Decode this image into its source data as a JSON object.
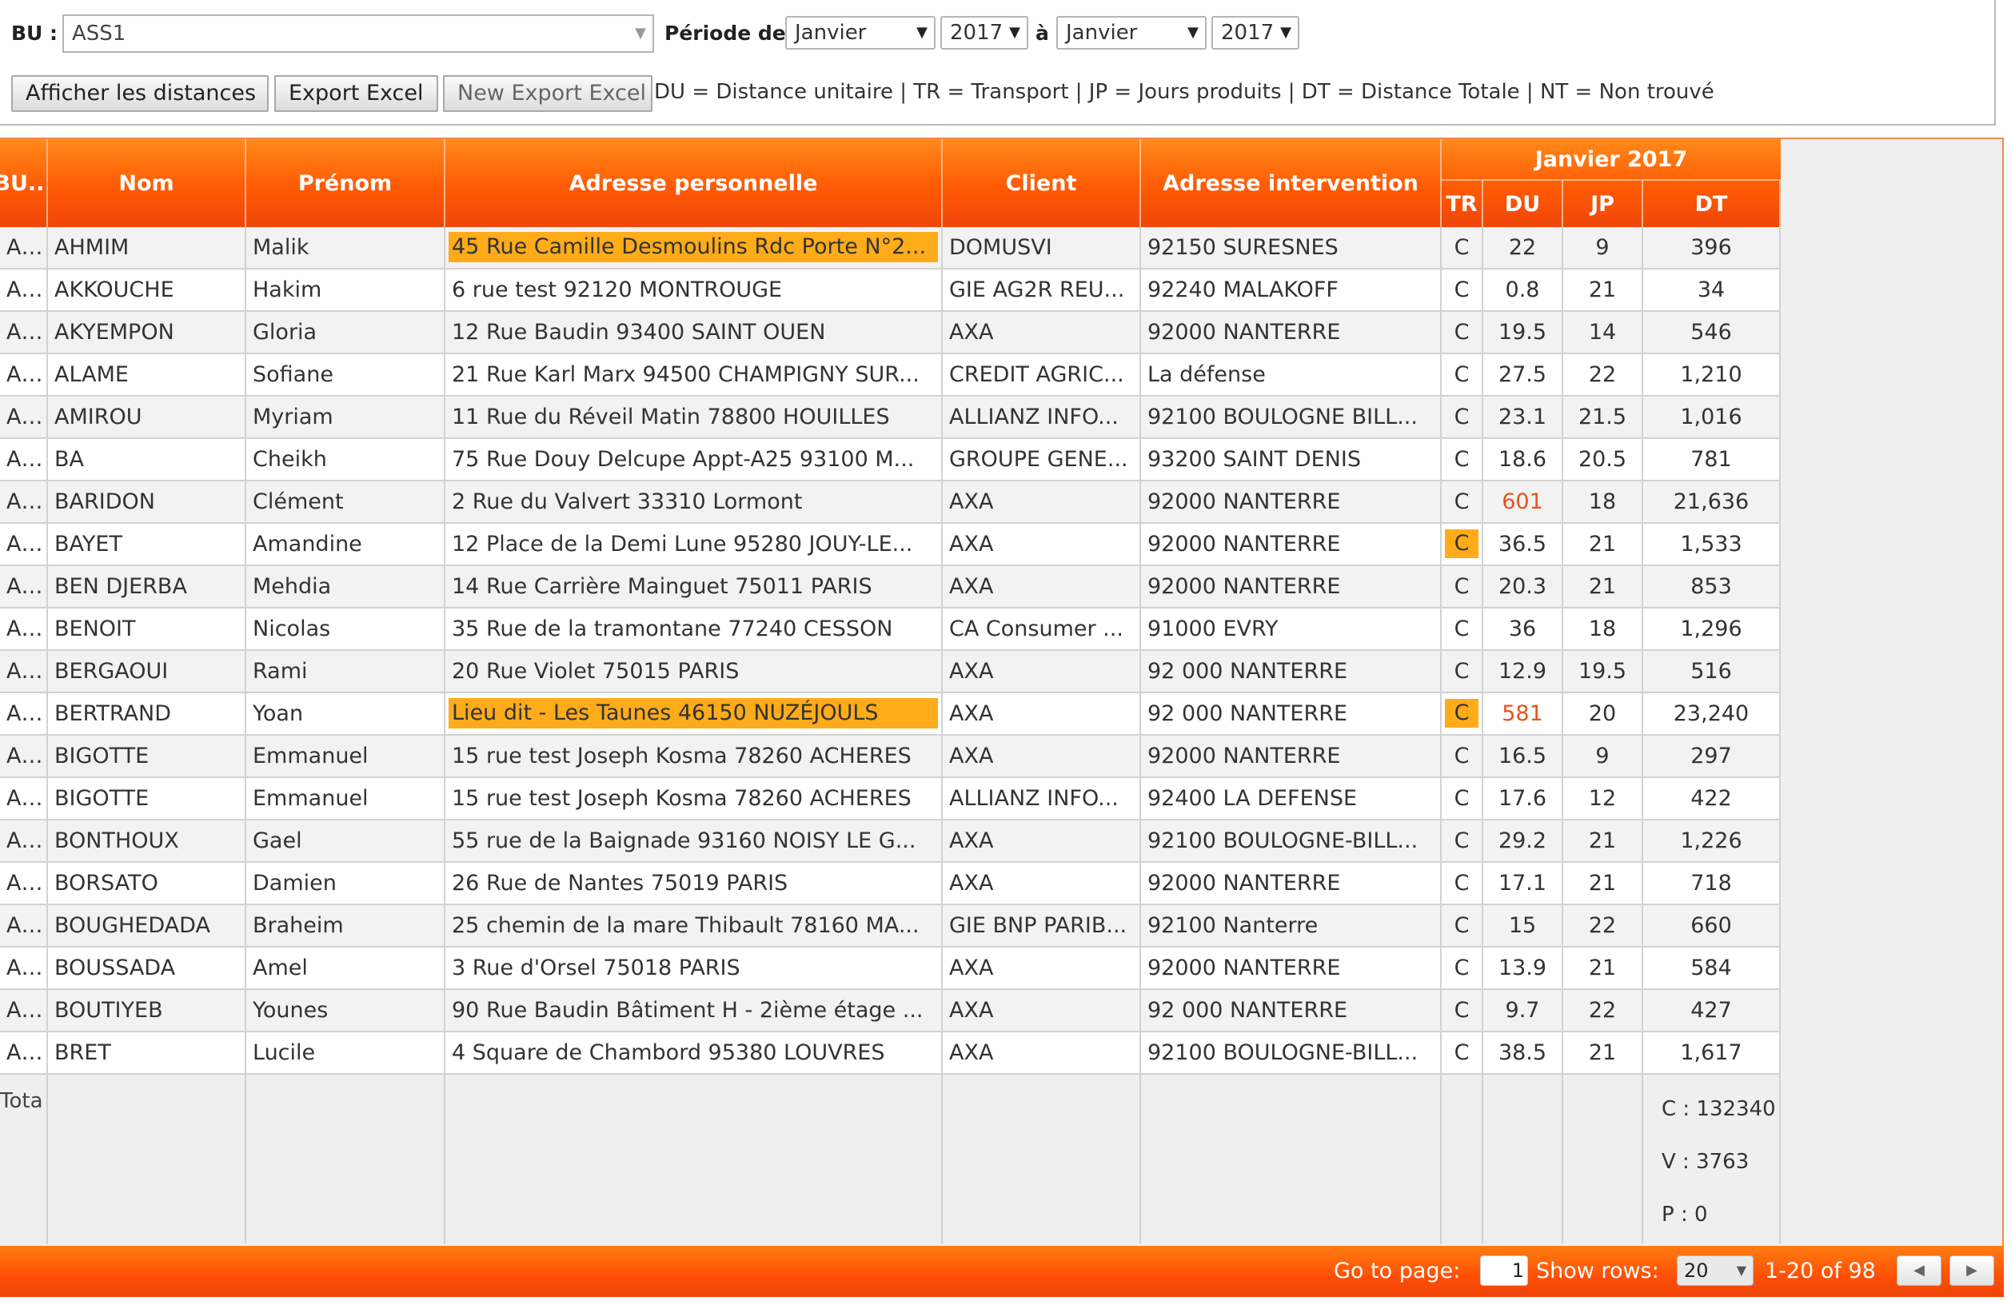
{
  "filters": {
    "bu_label": "BU :",
    "bu_value": "ASS1",
    "periode_label": "Période de",
    "from_month": "Janvier",
    "from_year": "2017",
    "to_label": "à",
    "to_month": "Janvier",
    "to_year": "2017"
  },
  "toolbar": {
    "show_distances": "Afficher les distances",
    "export_excel": "Export Excel",
    "new_export_excel": "New Export Excel",
    "legend": "DU = Distance unitaire  |  TR = Transport  |  JP = Jours produits  |  DT = Distance Totale  |  NT = Non trouvé"
  },
  "grid": {
    "headers": {
      "bu": "BU...",
      "nom": "Nom",
      "prenom": "Prénom",
      "adresse": "Adresse personnelle",
      "client": "Client",
      "intervention": "Adresse intervention",
      "period_group": "Janvier 2017",
      "tr": "TR",
      "du": "DU",
      "jp": "JP",
      "dt": "DT"
    },
    "rows": [
      {
        "bu": "AS...",
        "nom": "AHMIM",
        "prenom": "Malik",
        "adresse": "45 Rue Camille Desmoulins Rdc Porte N°2...",
        "client": "DOMUSVI",
        "intervention": "92150 SURESNES",
        "tr": "C",
        "du": "22",
        "jp": "9",
        "dt": "396"
      },
      {
        "bu": "AS...",
        "nom": "AKKOUCHE",
        "prenom": "Hakim",
        "adresse": "6 rue test 92120 MONTROUGE",
        "client": "GIE AG2R REU...",
        "intervention": "92240 MALAKOFF",
        "tr": "C",
        "du": "0.8",
        "jp": "21",
        "dt": "34"
      },
      {
        "bu": "AS...",
        "nom": "AKYEMPON",
        "prenom": "Gloria",
        "adresse": "12 Rue Baudin 93400 SAINT OUEN",
        "client": "AXA",
        "intervention": "92000 NANTERRE",
        "tr": "C",
        "du": "19.5",
        "jp": "14",
        "dt": "546"
      },
      {
        "bu": "AS...",
        "nom": "ALAME",
        "prenom": "Sofiane",
        "adresse": "21 Rue Karl Marx 94500 CHAMPIGNY SUR...",
        "client": "CREDIT AGRIC...",
        "intervention": "La défense",
        "tr": "C",
        "du": "27.5",
        "jp": "22",
        "dt": "1,210"
      },
      {
        "bu": "AS...",
        "nom": "AMIROU",
        "prenom": "Myriam",
        "adresse": "11 Rue du Réveil Matin 78800 HOUILLES",
        "client": "ALLIANZ INFO...",
        "intervention": "92100 BOULOGNE BILL...",
        "tr": "C",
        "du": "23.1",
        "jp": "21.5",
        "dt": "1,016"
      },
      {
        "bu": "AS...",
        "nom": "BA",
        "prenom": "Cheikh",
        "adresse": "75 Rue Douy Delcupe Appt-A25 93100 M...",
        "client": "GROUPE GENE...",
        "intervention": "93200 SAINT DENIS",
        "tr": "C",
        "du": "18.6",
        "jp": "20.5",
        "dt": "781"
      },
      {
        "bu": "AS...",
        "nom": "BARIDON",
        "prenom": "Clément",
        "adresse": "2 Rue du Valvert 33310 Lormont",
        "client": "AXA",
        "intervention": "92000 NANTERRE",
        "tr": "C",
        "du": "601",
        "jp": "18",
        "dt": "21,636"
      },
      {
        "bu": "AS...",
        "nom": "BAYET",
        "prenom": "Amandine",
        "adresse": "12 Place de la Demi Lune 95280 JOUY-LE...",
        "client": "AXA",
        "intervention": "92000 NANTERRE",
        "tr": "C",
        "du": "36.5",
        "jp": "21",
        "dt": "1,533"
      },
      {
        "bu": "AS...",
        "nom": "BEN DJERBA",
        "prenom": "Mehdia",
        "adresse": "14 Rue Carrière Mainguet 75011 PARIS",
        "client": "AXA",
        "intervention": "92000 NANTERRE",
        "tr": "C",
        "du": "20.3",
        "jp": "21",
        "dt": "853"
      },
      {
        "bu": "AS...",
        "nom": "BENOIT",
        "prenom": "Nicolas",
        "adresse": "35 Rue de la tramontane 77240 CESSON",
        "client": "CA Consumer ...",
        "intervention": "91000 EVRY",
        "tr": "C",
        "du": "36",
        "jp": "18",
        "dt": "1,296"
      },
      {
        "bu": "AS...",
        "nom": "BERGAOUI",
        "prenom": "Rami",
        "adresse": "20 Rue Violet 75015 PARIS",
        "client": "AXA",
        "intervention": "92 000 NANTERRE",
        "tr": "C",
        "du": "12.9",
        "jp": "19.5",
        "dt": "516"
      },
      {
        "bu": "AS...",
        "nom": "BERTRAND",
        "prenom": "Yoan",
        "adresse": "Lieu dit - Les Taunes 46150 NUZÉJOULS",
        "client": "AXA",
        "intervention": "92 000 NANTERRE",
        "tr": "C",
        "du": "581",
        "jp": "20",
        "dt": "23,240"
      },
      {
        "bu": "AS...",
        "nom": "BIGOTTE",
        "prenom": "Emmanuel",
        "adresse": "15 rue test Joseph Kosma 78260 ACHERES",
        "client": "AXA",
        "intervention": "92000 NANTERRE",
        "tr": "C",
        "du": "16.5",
        "jp": "9",
        "dt": "297"
      },
      {
        "bu": "AS...",
        "nom": "BIGOTTE",
        "prenom": "Emmanuel",
        "adresse": "15 rue test Joseph Kosma 78260 ACHERES",
        "client": "ALLIANZ INFO...",
        "intervention": "92400 LA DEFENSE",
        "tr": "C",
        "du": "17.6",
        "jp": "12",
        "dt": "422"
      },
      {
        "bu": "AS...",
        "nom": "BONTHOUX",
        "prenom": "Gael",
        "adresse": "55 rue de la Baignade 93160 NOISY LE G...",
        "client": "AXA",
        "intervention": "92100 BOULOGNE-BILL...",
        "tr": "C",
        "du": "29.2",
        "jp": "21",
        "dt": "1,226"
      },
      {
        "bu": "AS...",
        "nom": "BORSATO",
        "prenom": "Damien",
        "adresse": "26 Rue de Nantes 75019 PARIS",
        "client": "AXA",
        "intervention": "92000 NANTERRE",
        "tr": "C",
        "du": "17.1",
        "jp": "21",
        "dt": "718"
      },
      {
        "bu": "AS...",
        "nom": "BOUGHEDADA",
        "prenom": "Braheim",
        "adresse": "25 chemin de la mare Thibault 78160 MA...",
        "client": "GIE BNP PARIB...",
        "intervention": "92100 Nanterre",
        "tr": "C",
        "du": "15",
        "jp": "22",
        "dt": "660"
      },
      {
        "bu": "AS...",
        "nom": "BOUSSADA",
        "prenom": "Amel",
        "adresse": "3 Rue d'Orsel 75018 PARIS",
        "client": "AXA",
        "intervention": "92000 NANTERRE",
        "tr": "C",
        "du": "13.9",
        "jp": "21",
        "dt": "584"
      },
      {
        "bu": "AS...",
        "nom": "BOUTIYEB",
        "prenom": "Younes",
        "adresse": "90 Rue Baudin Bâtiment H - 2ième étage ...",
        "client": "AXA",
        "intervention": "92 000 NANTERRE",
        "tr": "C",
        "du": "9.7",
        "jp": "22",
        "dt": "427"
      },
      {
        "bu": "AS...",
        "nom": "BRET",
        "prenom": "Lucile",
        "adresse": "4 Square de Chambord 95380 LOUVRES",
        "client": "AXA",
        "intervention": "92100 BOULOGNE-BILL...",
        "tr": "C",
        "du": "38.5",
        "jp": "21",
        "dt": "1,617"
      }
    ],
    "totals": {
      "label": "Tota",
      "c": "C : 132340",
      "v": "V : 3763",
      "p": "P : 0"
    }
  },
  "pager": {
    "goto_label": "Go to page:",
    "page_value": "1",
    "rows_label": "Show rows:",
    "rows_value": "20",
    "range": "1-20 of 98"
  },
  "colors": {
    "header_orange": "#ff5a05",
    "highlight": "#ffab1a",
    "alert_red": "#e8531a"
  }
}
